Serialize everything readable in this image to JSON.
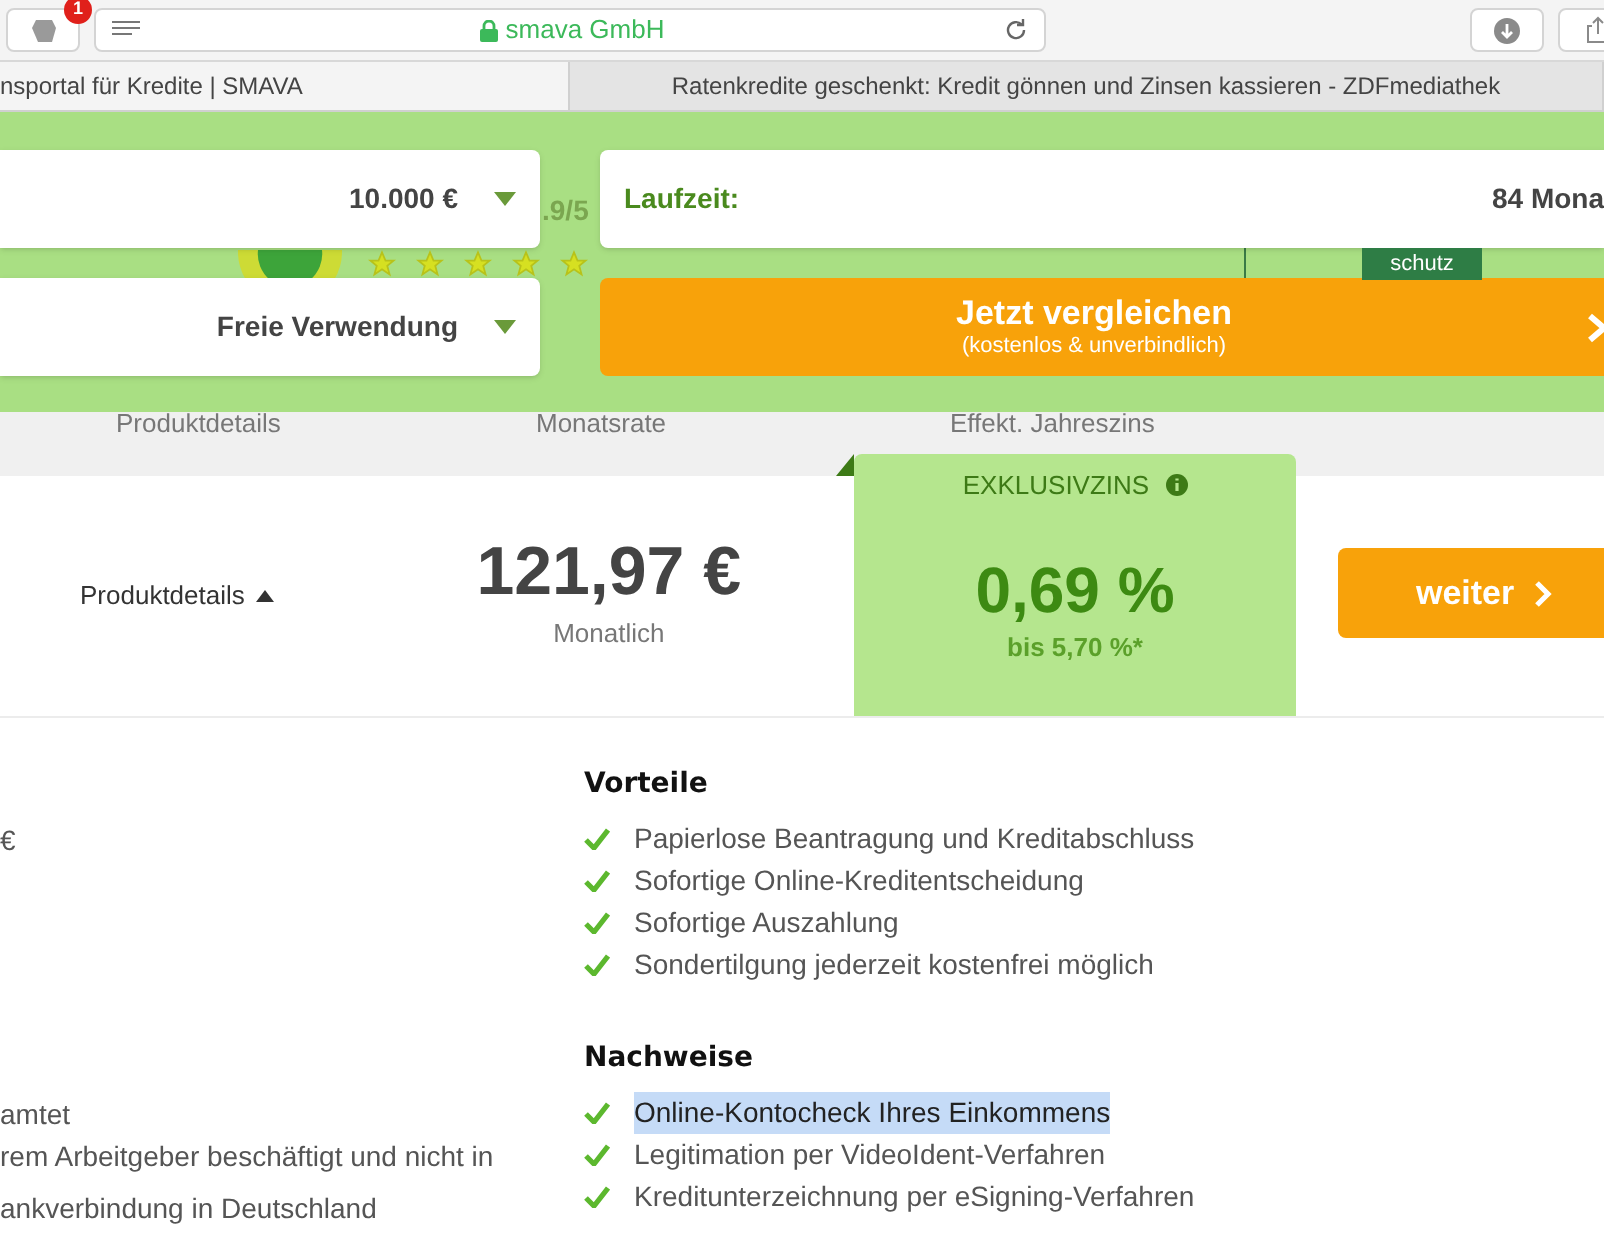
{
  "toolbar": {
    "extension_badge": "1",
    "address": "smava GmbH"
  },
  "tabs": [
    {
      "label": "nsportal für Kredite | SMAVA",
      "selected": true
    },
    {
      "label": "Ratenkredite geschenkt: Kredit gönnen und Zinsen kassieren - ZDFmediathek",
      "selected": false
    }
  ],
  "form": {
    "amount": "10.000 €",
    "purpose": "Freie Verwendung",
    "term_label": "Laufzeit:",
    "term_value": "84 Mona",
    "rating": ".9/5",
    "stars": 5,
    "seal_text": "schutz",
    "compare_button": {
      "title": "Jetzt vergleichen",
      "subtitle": "(kostenlos & unverbindlich)"
    }
  },
  "columns": [
    "Produktdetails",
    "Monatsrate",
    "Effekt. Jahreszins"
  ],
  "offer": {
    "details_toggle": "Produktdetails",
    "expanded": true,
    "monthly_rate": "121,97 €",
    "monthly_label": "Monatlich",
    "badge": "EXKLUSIVZINS",
    "rate": "0,69 %",
    "rate_range": "bis 5,70 %*",
    "button": "weiter"
  },
  "details_left": [
    [
      "€"
    ],
    [
      "amtet",
      "rem Arbeitgeber beschäftigt und nicht in",
      "ankverbindung in Deutschland"
    ]
  ],
  "sections": [
    {
      "title": "Vorteile",
      "items": [
        {
          "text": "Papierlose Beantragung und Kreditabschluss",
          "highlighted": false
        },
        {
          "text": "Sofortige Online-Kreditentscheidung",
          "highlighted": false
        },
        {
          "text": "Sofortige Auszahlung",
          "highlighted": false
        },
        {
          "text": "Sondertilgung jederzeit kostenfrei möglich",
          "highlighted": false
        }
      ]
    },
    {
      "title": "Nachweise",
      "items": [
        {
          "text": "Online-Kontocheck Ihres Einkommens",
          "highlighted": true
        },
        {
          "text": "Legitimation per VideoIdent-Verfahren",
          "highlighted": false
        },
        {
          "text": "Kreditunterzeichnung per eSigning-Verfahren",
          "highlighted": false
        }
      ]
    }
  ]
}
